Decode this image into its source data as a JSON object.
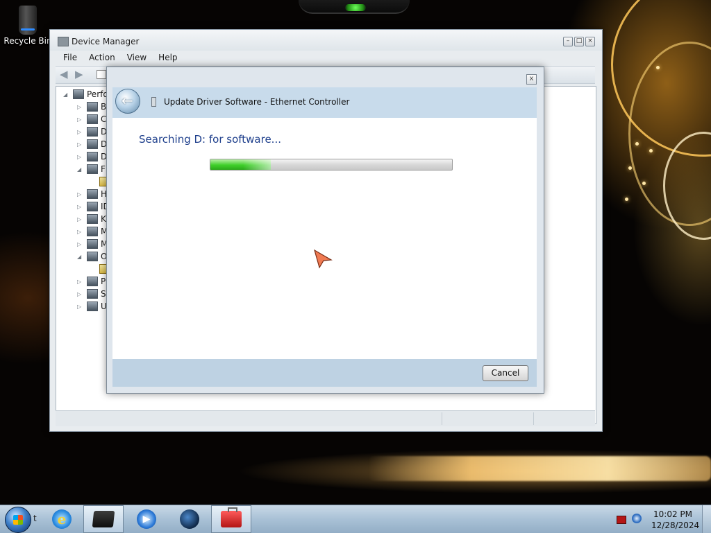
{
  "desktop": {
    "icons": [
      {
        "label": "Recycle Bin",
        "icon": "recycle-bin-icon"
      }
    ]
  },
  "device_manager": {
    "title": "Device Manager",
    "menu": [
      "File",
      "Action",
      "View",
      "Help"
    ],
    "tree_root": "Perfo",
    "tree_items": [
      "Ba",
      "C",
      "D",
      "D",
      "D",
      "Fl",
      "",
      "H",
      "ID",
      "Ke",
      "M",
      "M",
      "O",
      "",
      "Pr",
      "Sy",
      "U"
    ]
  },
  "dialog": {
    "title": "Update Driver Software - Ethernet Controller",
    "status": "Searching D: for software...",
    "progress": 0.25,
    "cancel_label": "Cancel",
    "close_label": "x"
  },
  "taskbar": {
    "start_label": "t",
    "apps": [
      {
        "name": "internet-explorer-icon",
        "active": false
      },
      {
        "name": "device-manager-icon",
        "active": true
      },
      {
        "name": "media-player-icon",
        "active": false
      },
      {
        "name": "globe-icon",
        "active": false
      },
      {
        "name": "toolbox-icon",
        "active": true
      }
    ],
    "time": "10:02 PM",
    "date": "12/28/2024"
  }
}
